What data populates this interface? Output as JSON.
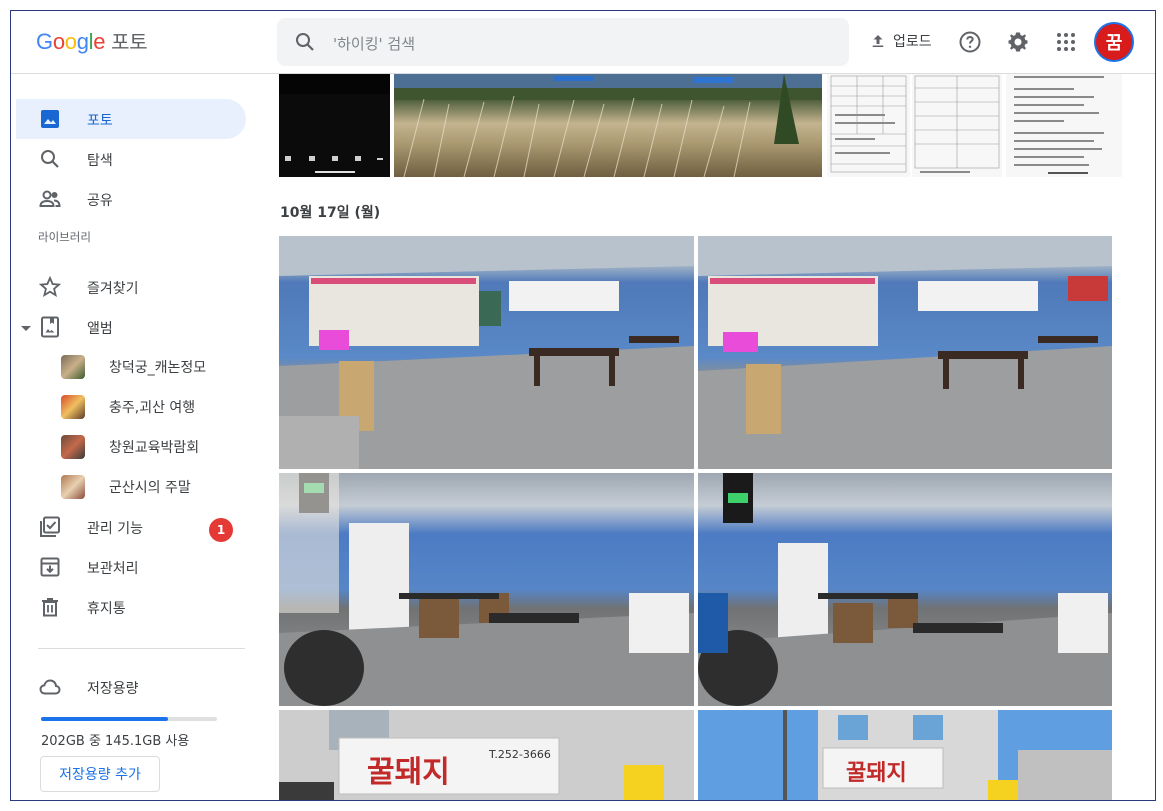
{
  "header": {
    "logo_letters": [
      "G",
      "o",
      "o",
      "g",
      "l",
      "e"
    ],
    "product": "포토",
    "search_placeholder": "'하이킹' 검색",
    "upload_label": "업로드",
    "avatar_initial": "꿈"
  },
  "sidebar": {
    "items": [
      {
        "label": "포토",
        "icon": "photo-icon",
        "active": true
      },
      {
        "label": "탐색",
        "icon": "search-icon"
      },
      {
        "label": "공유",
        "icon": "people-icon"
      }
    ],
    "library_label": "라이브러리",
    "library_items": [
      {
        "label": "즐겨찾기",
        "icon": "star-icon"
      },
      {
        "label": "앨범",
        "icon": "album-icon"
      }
    ],
    "albums": [
      {
        "label": "창덕궁_캐논정모"
      },
      {
        "label": "충주,괴산 여행"
      },
      {
        "label": "창원교육박람회"
      },
      {
        "label": "군산시의 주말"
      }
    ],
    "utility_items": [
      {
        "label": "관리 기능",
        "icon": "manage-icon",
        "badge": "1"
      },
      {
        "label": "보관처리",
        "icon": "archive-icon"
      },
      {
        "label": "휴지통",
        "icon": "trash-icon"
      }
    ],
    "storage": {
      "label": "저장용량",
      "usage_text": "202GB 중 145.1GB 사용",
      "used_fraction": 0.72,
      "button_label": "저장용량 추가"
    }
  },
  "main": {
    "date_label": "10월 17일 (월)",
    "photos": [
      {
        "desc": "screen-recording"
      },
      {
        "desc": "silver-grass-field"
      },
      {
        "desc": "document-scan-1"
      },
      {
        "desc": "document-scan-2"
      },
      {
        "desc": "document-scan-3"
      },
      {
        "desc": "restaurant-interior-1"
      },
      {
        "desc": "restaurant-interior-2"
      },
      {
        "desc": "restaurant-interior-3"
      },
      {
        "desc": "restaurant-interior-4"
      },
      {
        "desc": "restaurant-sign-1"
      },
      {
        "desc": "restaurant-sign-2"
      }
    ],
    "sign_text": "꿀돼지",
    "sign_phone": "T.252-3666"
  },
  "colors": {
    "accent": "#1a73e8",
    "active_bg": "#e8f0fe",
    "badge": "#e53935"
  }
}
